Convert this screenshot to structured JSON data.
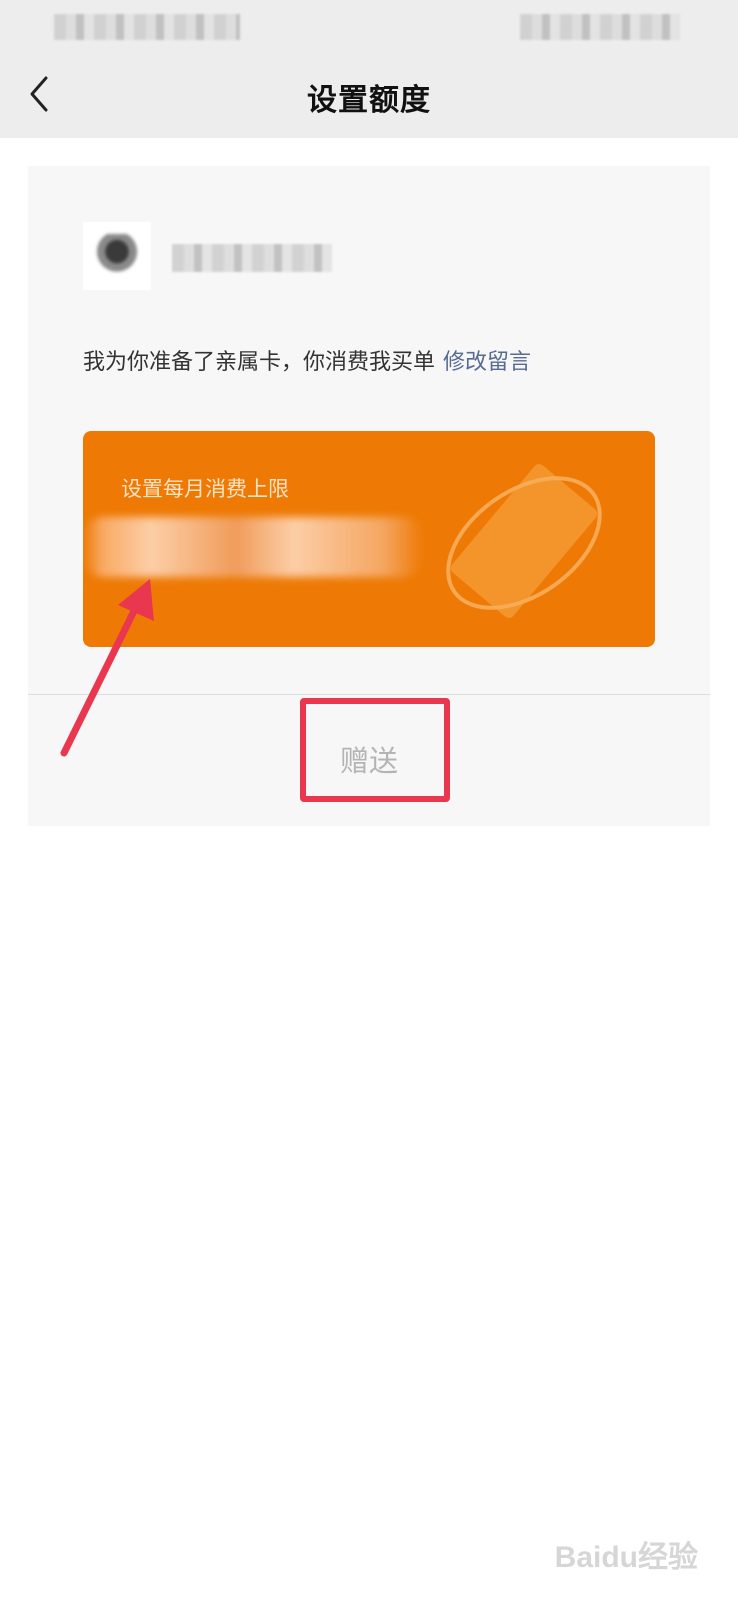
{
  "nav": {
    "title": "设置额度",
    "back_icon": "chevron-left-icon"
  },
  "card": {
    "message": "我为你准备了亲属卡，你消费我买单",
    "edit_message_link": "修改留言",
    "quota_label": "设置每月消费上限",
    "send_label": "赠送"
  },
  "colors": {
    "nav_background": "#ededed",
    "quota_card": "#ee7a05",
    "link": "#576b95",
    "annotation": "#e8374f"
  },
  "watermark": {
    "text": "Baidu经验"
  }
}
